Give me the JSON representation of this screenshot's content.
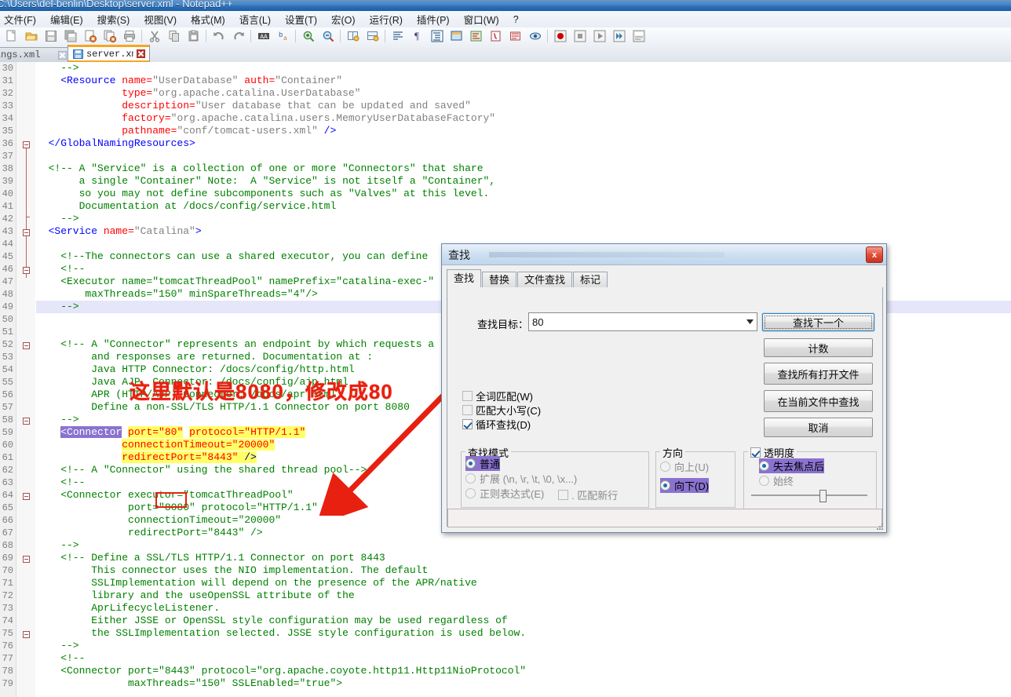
{
  "window": {
    "title": "C:\\Users\\del-benlin\\Desktop\\server.xml - Notepad++"
  },
  "menu": {
    "items": [
      {
        "label": "文件(F)"
      },
      {
        "label": "编辑(E)"
      },
      {
        "label": "搜索(S)"
      },
      {
        "label": "视图(V)"
      },
      {
        "label": "格式(M)"
      },
      {
        "label": "语言(L)"
      },
      {
        "label": "设置(T)"
      },
      {
        "label": "宏(O)"
      },
      {
        "label": "运行(R)"
      },
      {
        "label": "插件(P)"
      },
      {
        "label": "窗口(W)"
      },
      {
        "label": "?"
      }
    ]
  },
  "toolbar": {
    "icons": [
      "new-file-icon",
      "open-folder-icon",
      "save-icon",
      "save-all-icon",
      "close-file-icon",
      "close-all-icon",
      "print-icon",
      "sep",
      "cut-icon",
      "copy-icon",
      "paste-icon",
      "sep",
      "undo-icon",
      "redo-icon",
      "sep",
      "find-icon",
      "replace-icon",
      "sep",
      "zoom-in-icon",
      "zoom-out-icon",
      "sep",
      "sync-vertical-icon",
      "sync-horizontal-icon",
      "sep",
      "word-wrap-icon",
      "show-all-chars-icon",
      "indent-guide-icon",
      "user-defined-dialog-icon",
      "document-map-icon",
      "function-list-icon",
      "folder-workspace-icon",
      "monitoring-icon",
      "sep",
      "record-macro-icon",
      "stop-macro-icon",
      "play-macro-icon",
      "fast-play-macro-icon",
      "save-macro-icon"
    ]
  },
  "tabs": [
    {
      "label": "settings.xml",
      "active": false
    },
    {
      "label": "server.xml",
      "active": true
    }
  ],
  "editor": {
    "first_line_number": 30,
    "highlighted_line_number": 49,
    "annotation": "这里默认是8080，修改成80",
    "lines": [
      {
        "n": 30,
        "segs": [
          {
            "t": "    -->",
            "c": "cmt"
          }
        ]
      },
      {
        "n": 31,
        "segs": [
          {
            "t": "    <Resource ",
            "c": "tag"
          },
          {
            "t": "name=",
            "c": "attr"
          },
          {
            "t": "\"UserDatabase\" ",
            "c": "val"
          },
          {
            "t": "auth=",
            "c": "attr"
          },
          {
            "t": "\"Container\"",
            "c": "val"
          }
        ]
      },
      {
        "n": 32,
        "segs": [
          {
            "t": "              ",
            "c": "plain"
          },
          {
            "t": "type=",
            "c": "attr"
          },
          {
            "t": "\"org.apache.catalina.UserDatabase\"",
            "c": "val"
          }
        ]
      },
      {
        "n": 33,
        "segs": [
          {
            "t": "              ",
            "c": "plain"
          },
          {
            "t": "description=",
            "c": "attr"
          },
          {
            "t": "\"User database that can be updated and saved\"",
            "c": "val"
          }
        ]
      },
      {
        "n": 34,
        "segs": [
          {
            "t": "              ",
            "c": "plain"
          },
          {
            "t": "factory=",
            "c": "attr"
          },
          {
            "t": "\"org.apache.catalina.users.MemoryUserDatabaseFactory\"",
            "c": "val"
          }
        ]
      },
      {
        "n": 35,
        "segs": [
          {
            "t": "              ",
            "c": "plain"
          },
          {
            "t": "pathname=",
            "c": "attr"
          },
          {
            "t": "\"conf/tomcat-users.xml\" ",
            "c": "val"
          },
          {
            "t": "/>",
            "c": "tag"
          }
        ]
      },
      {
        "n": 36,
        "segs": [
          {
            "t": "  </GlobalNamingResources>",
            "c": "tag"
          }
        ]
      },
      {
        "n": 37,
        "segs": [
          {
            "t": "",
            "c": "plain"
          }
        ]
      },
      {
        "n": 38,
        "segs": [
          {
            "t": "  <!-- A \"Service\" is a collection of one or more \"Connectors\" that share",
            "c": "cmt"
          }
        ]
      },
      {
        "n": 39,
        "segs": [
          {
            "t": "       a single \"Container\" Note:  A \"Service\" is not itself a \"Container\",",
            "c": "cmt"
          }
        ]
      },
      {
        "n": 40,
        "segs": [
          {
            "t": "       so you may not define subcomponents such as \"Valves\" at this level.",
            "c": "cmt"
          }
        ]
      },
      {
        "n": 41,
        "segs": [
          {
            "t": "       Documentation at /docs/config/service.html",
            "c": "cmt"
          }
        ]
      },
      {
        "n": 42,
        "segs": [
          {
            "t": "    -->",
            "c": "cmt"
          }
        ]
      },
      {
        "n": 43,
        "segs": [
          {
            "t": "  <Service ",
            "c": "tag"
          },
          {
            "t": "name=",
            "c": "attr"
          },
          {
            "t": "\"Catalina\"",
            "c": "val"
          },
          {
            "t": ">",
            "c": "tag"
          }
        ]
      },
      {
        "n": 44,
        "segs": [
          {
            "t": "",
            "c": "plain"
          }
        ]
      },
      {
        "n": 45,
        "segs": [
          {
            "t": "    <!--The connectors can use a shared executor, you can define",
            "c": "cmt"
          }
        ]
      },
      {
        "n": 46,
        "segs": [
          {
            "t": "    <!--",
            "c": "cmt"
          }
        ]
      },
      {
        "n": 47,
        "segs": [
          {
            "t": "    <Executor name=\"tomcatThreadPool\" namePrefix=\"catalina-exec-\"",
            "c": "cmt"
          }
        ]
      },
      {
        "n": 48,
        "segs": [
          {
            "t": "        maxThreads=\"150\" minSpareThreads=\"4\"/>",
            "c": "cmt"
          }
        ]
      },
      {
        "n": 49,
        "segs": [
          {
            "t": "    -->",
            "c": "cmt"
          }
        ]
      },
      {
        "n": 50,
        "segs": [
          {
            "t": "",
            "c": "plain"
          }
        ]
      },
      {
        "n": 51,
        "segs": [
          {
            "t": "",
            "c": "plain"
          }
        ]
      },
      {
        "n": 52,
        "segs": [
          {
            "t": "    <!-- A \"Connector\" represents an endpoint by which requests a",
            "c": "cmt"
          }
        ]
      },
      {
        "n": 53,
        "segs": [
          {
            "t": "         and responses are returned. Documentation at :",
            "c": "cmt"
          }
        ]
      },
      {
        "n": 54,
        "segs": [
          {
            "t": "         Java HTTP Connector: /docs/config/http.html",
            "c": "cmt"
          }
        ]
      },
      {
        "n": 55,
        "segs": [
          {
            "t": "         Java AJP  Connector: /docs/config/ajp.html",
            "c": "cmt"
          }
        ]
      },
      {
        "n": 56,
        "segs": [
          {
            "t": "         APR (HTTP/AJP) Connector: /docs/apr.html",
            "c": "cmt"
          }
        ]
      },
      {
        "n": 57,
        "segs": [
          {
            "t": "         Define a non-SSL/TLS HTTP/1.1 Connector on port 8080",
            "c": "cmt"
          }
        ]
      },
      {
        "n": 58,
        "segs": [
          {
            "t": "    -->",
            "c": "cmt"
          }
        ]
      },
      {
        "n": 59,
        "segs": [
          {
            "t": "    ",
            "c": "plain"
          },
          {
            "t": "<Connector",
            "c": "sel"
          },
          {
            "t": " ",
            "c": "plain"
          },
          {
            "t": "port=\"80\"",
            "c": "mark-attr"
          },
          {
            "t": " ",
            "c": "plain"
          },
          {
            "t": "protocol=\"HTTP/1.1\"",
            "c": "mark-attr"
          }
        ]
      },
      {
        "n": 60,
        "segs": [
          {
            "t": "              ",
            "c": "plain"
          },
          {
            "t": "connectionTimeout=\"20000\"",
            "c": "mark-attr"
          }
        ]
      },
      {
        "n": 61,
        "segs": [
          {
            "t": "              ",
            "c": "plain"
          },
          {
            "t": "redirectPort=\"8443\" ",
            "c": "mark-attr"
          },
          {
            "t": "/>",
            "c": "mark-tag"
          }
        ]
      },
      {
        "n": 62,
        "segs": [
          {
            "t": "    <!-- A \"Connector\" using the shared thread pool-->",
            "c": "cmt"
          }
        ]
      },
      {
        "n": 63,
        "segs": [
          {
            "t": "    <!--",
            "c": "cmt"
          }
        ]
      },
      {
        "n": 64,
        "segs": [
          {
            "t": "    <Connector executor=\"tomcatThreadPool\"",
            "c": "cmt"
          }
        ]
      },
      {
        "n": 65,
        "segs": [
          {
            "t": "               port=\"8080\" protocol=\"HTTP/1.1\"",
            "c": "cmt"
          }
        ]
      },
      {
        "n": 66,
        "segs": [
          {
            "t": "               connectionTimeout=\"20000\"",
            "c": "cmt"
          }
        ]
      },
      {
        "n": 67,
        "segs": [
          {
            "t": "               redirectPort=\"8443\" />",
            "c": "cmt"
          }
        ]
      },
      {
        "n": 68,
        "segs": [
          {
            "t": "    -->",
            "c": "cmt"
          }
        ]
      },
      {
        "n": 69,
        "segs": [
          {
            "t": "    <!-- Define a SSL/TLS HTTP/1.1 Connector on port 8443",
            "c": "cmt"
          }
        ]
      },
      {
        "n": 70,
        "segs": [
          {
            "t": "         This connector uses the NIO implementation. The default",
            "c": "cmt"
          }
        ]
      },
      {
        "n": 71,
        "segs": [
          {
            "t": "         SSLImplementation will depend on the presence of the APR/native",
            "c": "cmt"
          }
        ]
      },
      {
        "n": 72,
        "segs": [
          {
            "t": "         library and the useOpenSSL attribute of the",
            "c": "cmt"
          }
        ]
      },
      {
        "n": 73,
        "segs": [
          {
            "t": "         AprLifecycleListener.",
            "c": "cmt"
          }
        ]
      },
      {
        "n": 74,
        "segs": [
          {
            "t": "         Either JSSE or OpenSSL style configuration may be used regardless of",
            "c": "cmt"
          }
        ]
      },
      {
        "n": 75,
        "segs": [
          {
            "t": "         the SSLImplementation selected. JSSE style configuration is used below.",
            "c": "cmt"
          }
        ]
      },
      {
        "n": 76,
        "segs": [
          {
            "t": "    -->",
            "c": "cmt"
          }
        ]
      },
      {
        "n": 77,
        "segs": [
          {
            "t": "    <!--",
            "c": "cmt"
          }
        ]
      },
      {
        "n": 78,
        "segs": [
          {
            "t": "    <Connector port=\"8443\" protocol=\"org.apache.coyote.http11.Http11NioProtocol\"",
            "c": "cmt"
          }
        ]
      },
      {
        "n": 79,
        "segs": [
          {
            "t": "               maxThreads=\"150\" SSLEnabled=\"true\">",
            "c": "cmt"
          }
        ]
      }
    ]
  },
  "find_dialog": {
    "title": "查找",
    "close_label": "x",
    "tabs": [
      {
        "label": "查找",
        "active": true
      },
      {
        "label": "替换",
        "active": false
      },
      {
        "label": "文件查找",
        "active": false
      },
      {
        "label": "标记",
        "active": false
      }
    ],
    "find_what_label": "查找目标：",
    "find_what_value": "80",
    "buttons": [
      {
        "label": "查找下一个",
        "default": true
      },
      {
        "label": "计数",
        "default": false
      },
      {
        "label": "查找所有打开文件",
        "default": false
      },
      {
        "label": "在当前文件中查找",
        "default": false
      },
      {
        "label": "取消",
        "default": false
      }
    ],
    "checkboxes": [
      {
        "label": "全词匹配(W)",
        "checked": false
      },
      {
        "label": "匹配大小写(C)",
        "checked": false
      },
      {
        "label": "循环查找(D)",
        "checked": true
      }
    ],
    "search_mode": {
      "title": "查找模式",
      "options": [
        {
          "label": "普通",
          "selected": true,
          "disabled": false
        },
        {
          "label": "扩展 (\\n, \\r, \\t, \\0, \\x...)",
          "selected": false,
          "disabled": true
        },
        {
          "label": "正则表达式(E)",
          "selected": false,
          "disabled": true
        }
      ],
      "dotmatch": {
        "label": ". 匹配新行",
        "checked": false,
        "disabled": true
      }
    },
    "direction": {
      "title": "方向",
      "options": [
        {
          "label": "向上(U)",
          "selected": false,
          "disabled": true
        },
        {
          "label": "向下(D)",
          "selected": true,
          "disabled": false
        }
      ]
    },
    "transparency": {
      "title": "透明度",
      "checked": true,
      "options": [
        {
          "label": "失去焦点后",
          "selected": true,
          "disabled": false
        },
        {
          "label": "始终",
          "selected": false,
          "disabled": true
        }
      ],
      "slider_percent": 62
    },
    "status_text": ""
  },
  "colors": {
    "accent": "#f6a623",
    "annotation_red": "#e8200f",
    "comment_green": "#008000",
    "tag_blue": "#0000ff",
    "attr_red": "#ff0000",
    "value_gray": "#808080",
    "selection_purple": "#8a72d0",
    "mark_yellow": "#ffff66",
    "current_line": "#e6e6fa"
  }
}
